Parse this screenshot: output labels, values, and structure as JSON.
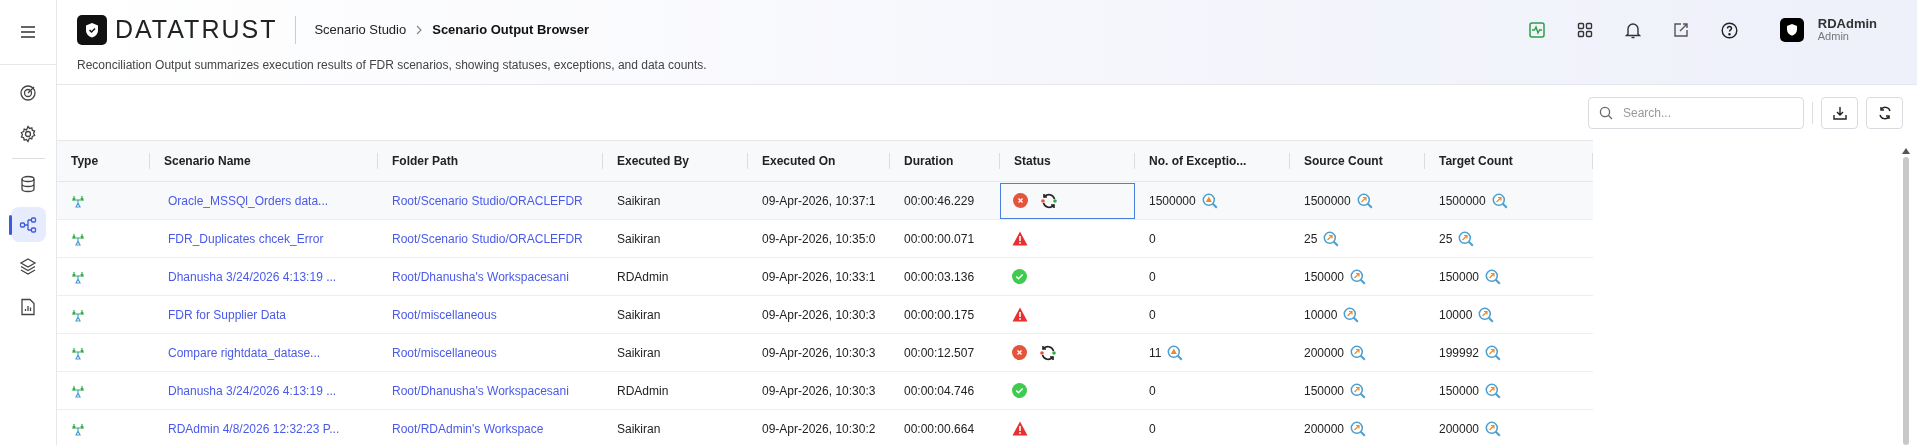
{
  "header": {
    "logo": "DATATRUST",
    "breadcrumbs": [
      {
        "label": "Scenario Studio",
        "current": false
      },
      {
        "label": "Scenario Output Browser",
        "current": true
      }
    ],
    "description": "Reconciliation Output summarizes execution results of FDR scenarios, showing statuses, exceptions, and data counts.",
    "user": {
      "name": "RDAdmin",
      "role": "Admin"
    }
  },
  "sidebar": {
    "items": [
      {
        "kind": "target",
        "selected": false
      },
      {
        "kind": "settings",
        "selected": false
      },
      {
        "kind": "database",
        "selected": false
      },
      {
        "kind": "flow",
        "selected": true
      },
      {
        "kind": "layers",
        "selected": false
      },
      {
        "kind": "report",
        "selected": false
      }
    ]
  },
  "search": {
    "placeholder": "Search..."
  },
  "table": {
    "columns": [
      "Type",
      "Scenario Name",
      "Folder Path",
      "Executed By",
      "Executed On",
      "Duration",
      "Status",
      "No. of Exceptio...",
      "Source Count",
      "Target Count"
    ],
    "rows": [
      {
        "selected": true,
        "name": "Oracle_MSSQl_Orders data...",
        "folder": "Root/Scenario Studio/ORACLEFDR",
        "executed_by": "Saikiran",
        "executed_on": "09-Apr-2026, 10:37:1",
        "duration": "00:00:46.229",
        "kind": "failed",
        "rerun": true,
        "exceptions": "1500000",
        "exceptions_drilldown": true,
        "source": "1500000",
        "target": "1500000"
      },
      {
        "selected": false,
        "name": "FDR_Duplicates chcek_Error",
        "folder": "Root/Scenario Studio/ORACLEFDR",
        "executed_by": "Saikiran",
        "executed_on": "09-Apr-2026, 10:35:0",
        "duration": "00:00:00.071",
        "kind": "warning",
        "rerun": false,
        "exceptions": "0",
        "exceptions_drilldown": false,
        "source": "25",
        "target": "25"
      },
      {
        "selected": false,
        "name": "Dhanusha 3/24/2026 4:13:19 ...",
        "folder": "Root/Dhanusha's Workspacesani",
        "executed_by": "RDAdmin",
        "executed_on": "09-Apr-2026, 10:33:1",
        "duration": "00:00:03.136",
        "kind": "success",
        "rerun": false,
        "exceptions": "0",
        "exceptions_drilldown": false,
        "source": "150000",
        "target": "150000"
      },
      {
        "selected": false,
        "name": "FDR for Supplier Data",
        "folder": "Root/miscellaneous",
        "executed_by": "Saikiran",
        "executed_on": "09-Apr-2026, 10:30:3",
        "duration": "00:00:00.175",
        "kind": "warning",
        "rerun": false,
        "exceptions": "0",
        "exceptions_drilldown": false,
        "source": "10000",
        "target": "10000"
      },
      {
        "selected": false,
        "name": "Compare rightdata_datase...",
        "folder": "Root/miscellaneous",
        "executed_by": "Saikiran",
        "executed_on": "09-Apr-2026, 10:30:3",
        "duration": "00:00:12.507",
        "kind": "failed",
        "rerun": true,
        "exceptions": "11",
        "exceptions_drilldown": true,
        "source": "200000",
        "target": "199992"
      },
      {
        "selected": false,
        "name": "Dhanusha 3/24/2026 4:13:19 ...",
        "folder": "Root/Dhanusha's Workspacesani",
        "executed_by": "RDAdmin",
        "executed_on": "09-Apr-2026, 10:30:3",
        "duration": "00:00:04.746",
        "kind": "success",
        "rerun": false,
        "exceptions": "0",
        "exceptions_drilldown": false,
        "source": "150000",
        "target": "150000"
      },
      {
        "selected": false,
        "name": "RDAdmin 4/8/2026 12:32:23 P...",
        "folder": "Root/RDAdmin's Workspace",
        "executed_by": "Saikiran",
        "executed_on": "09-Apr-2026, 10:30:2",
        "duration": "00:00:00.664",
        "kind": "warning",
        "rerun": false,
        "exceptions": "0",
        "exceptions_drilldown": false,
        "source": "200000",
        "target": "200000"
      }
    ]
  }
}
